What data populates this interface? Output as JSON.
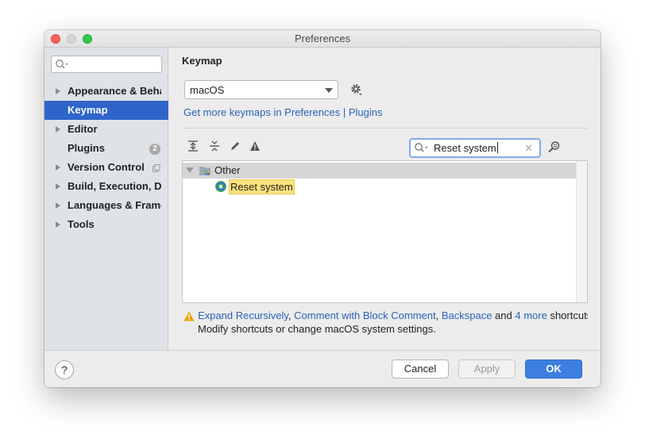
{
  "window": {
    "title": "Preferences"
  },
  "sidebar": {
    "search_placeholder": "",
    "items": [
      {
        "label": "Appearance & Behavior"
      },
      {
        "label": "Keymap"
      },
      {
        "label": "Editor"
      },
      {
        "label": "Plugins",
        "badge": "2"
      },
      {
        "label": "Version Control"
      },
      {
        "label": "Build, Execution, Deployment"
      },
      {
        "label": "Languages & Frameworks"
      },
      {
        "label": "Tools"
      }
    ]
  },
  "main": {
    "title": "Keymap",
    "keymap_select": "macOS",
    "link_text": "Get more keymaps in Preferences | Plugins",
    "search_value": "Reset system",
    "tree": {
      "group": "Other",
      "action": "Reset system"
    },
    "warning": {
      "link1": "Expand Recursively",
      "sep1": ", ",
      "link2": "Comment with Block Comment",
      "sep2": ", ",
      "link3": "Backspace",
      "and": " and ",
      "link4": "4 more",
      "suffix": " shortcuts",
      "line2": "Modify shortcuts or change macOS system settings."
    }
  },
  "footer": {
    "help": "?",
    "cancel": "Cancel",
    "apply": "Apply",
    "ok": "OK"
  },
  "colors": {
    "selection": "#2f65ca",
    "link": "#2a63b8",
    "ok_button": "#3d7fe0",
    "highlight": "#fbe27d",
    "warning": "#f0a30a"
  }
}
